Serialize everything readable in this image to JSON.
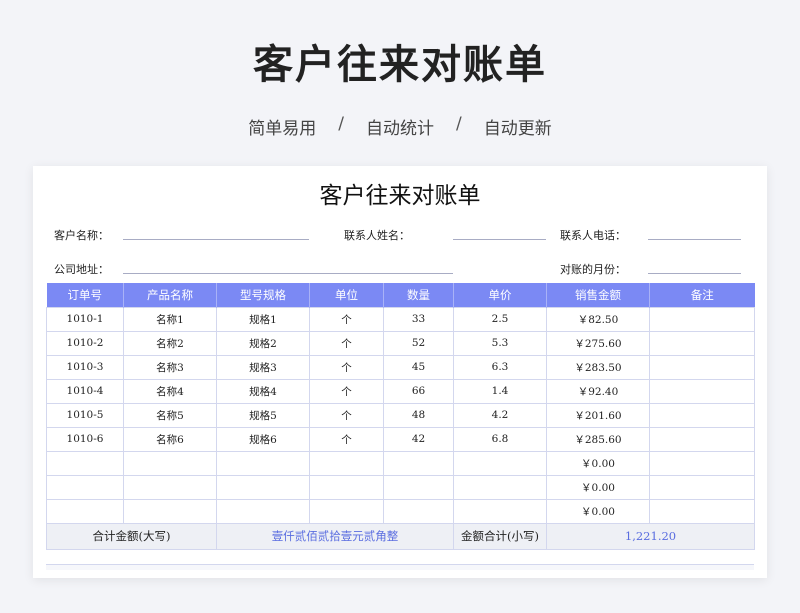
{
  "hero": {
    "title": "客户往来对账单",
    "features": [
      "简单易用",
      "自动统计",
      "自动更新"
    ],
    "separator": "/"
  },
  "sheet": {
    "title": "客户往来对账单",
    "fields": {
      "customer_name": "客户名称：",
      "contact_name": "联系人姓名：",
      "contact_phone": "联系人电话：",
      "address": "公司地址：",
      "month": "对账的月份："
    }
  },
  "table": {
    "headers": [
      "订单号",
      "产品名称",
      "型号规格",
      "单位",
      "数量",
      "单价",
      "销售金额",
      "备注"
    ],
    "rows": [
      [
        "1010-1",
        "名称1",
        "规格1",
        "个",
        "33",
        "2.5",
        "￥82.50",
        ""
      ],
      [
        "1010-2",
        "名称2",
        "规格2",
        "个",
        "52",
        "5.3",
        "￥275.60",
        ""
      ],
      [
        "1010-3",
        "名称3",
        "规格3",
        "个",
        "45",
        "6.3",
        "￥283.50",
        ""
      ],
      [
        "1010-4",
        "名称4",
        "规格4",
        "个",
        "66",
        "1.4",
        "￥92.40",
        ""
      ],
      [
        "1010-5",
        "名称5",
        "规格5",
        "个",
        "48",
        "4.2",
        "￥201.60",
        ""
      ],
      [
        "1010-6",
        "名称6",
        "规格6",
        "个",
        "42",
        "6.8",
        "￥285.60",
        ""
      ],
      [
        "",
        "",
        "",
        "",
        "",
        "",
        "￥0.00",
        ""
      ],
      [
        "",
        "",
        "",
        "",
        "",
        "",
        "￥0.00",
        ""
      ],
      [
        "",
        "",
        "",
        "",
        "",
        "",
        "￥0.00",
        ""
      ]
    ],
    "total": {
      "upper_label": "合计金额(大写)",
      "upper_value": "壹仟贰佰贰拾壹元贰角整",
      "lower_label": "金额合计(小写)",
      "lower_value": "1,221.20"
    }
  }
}
